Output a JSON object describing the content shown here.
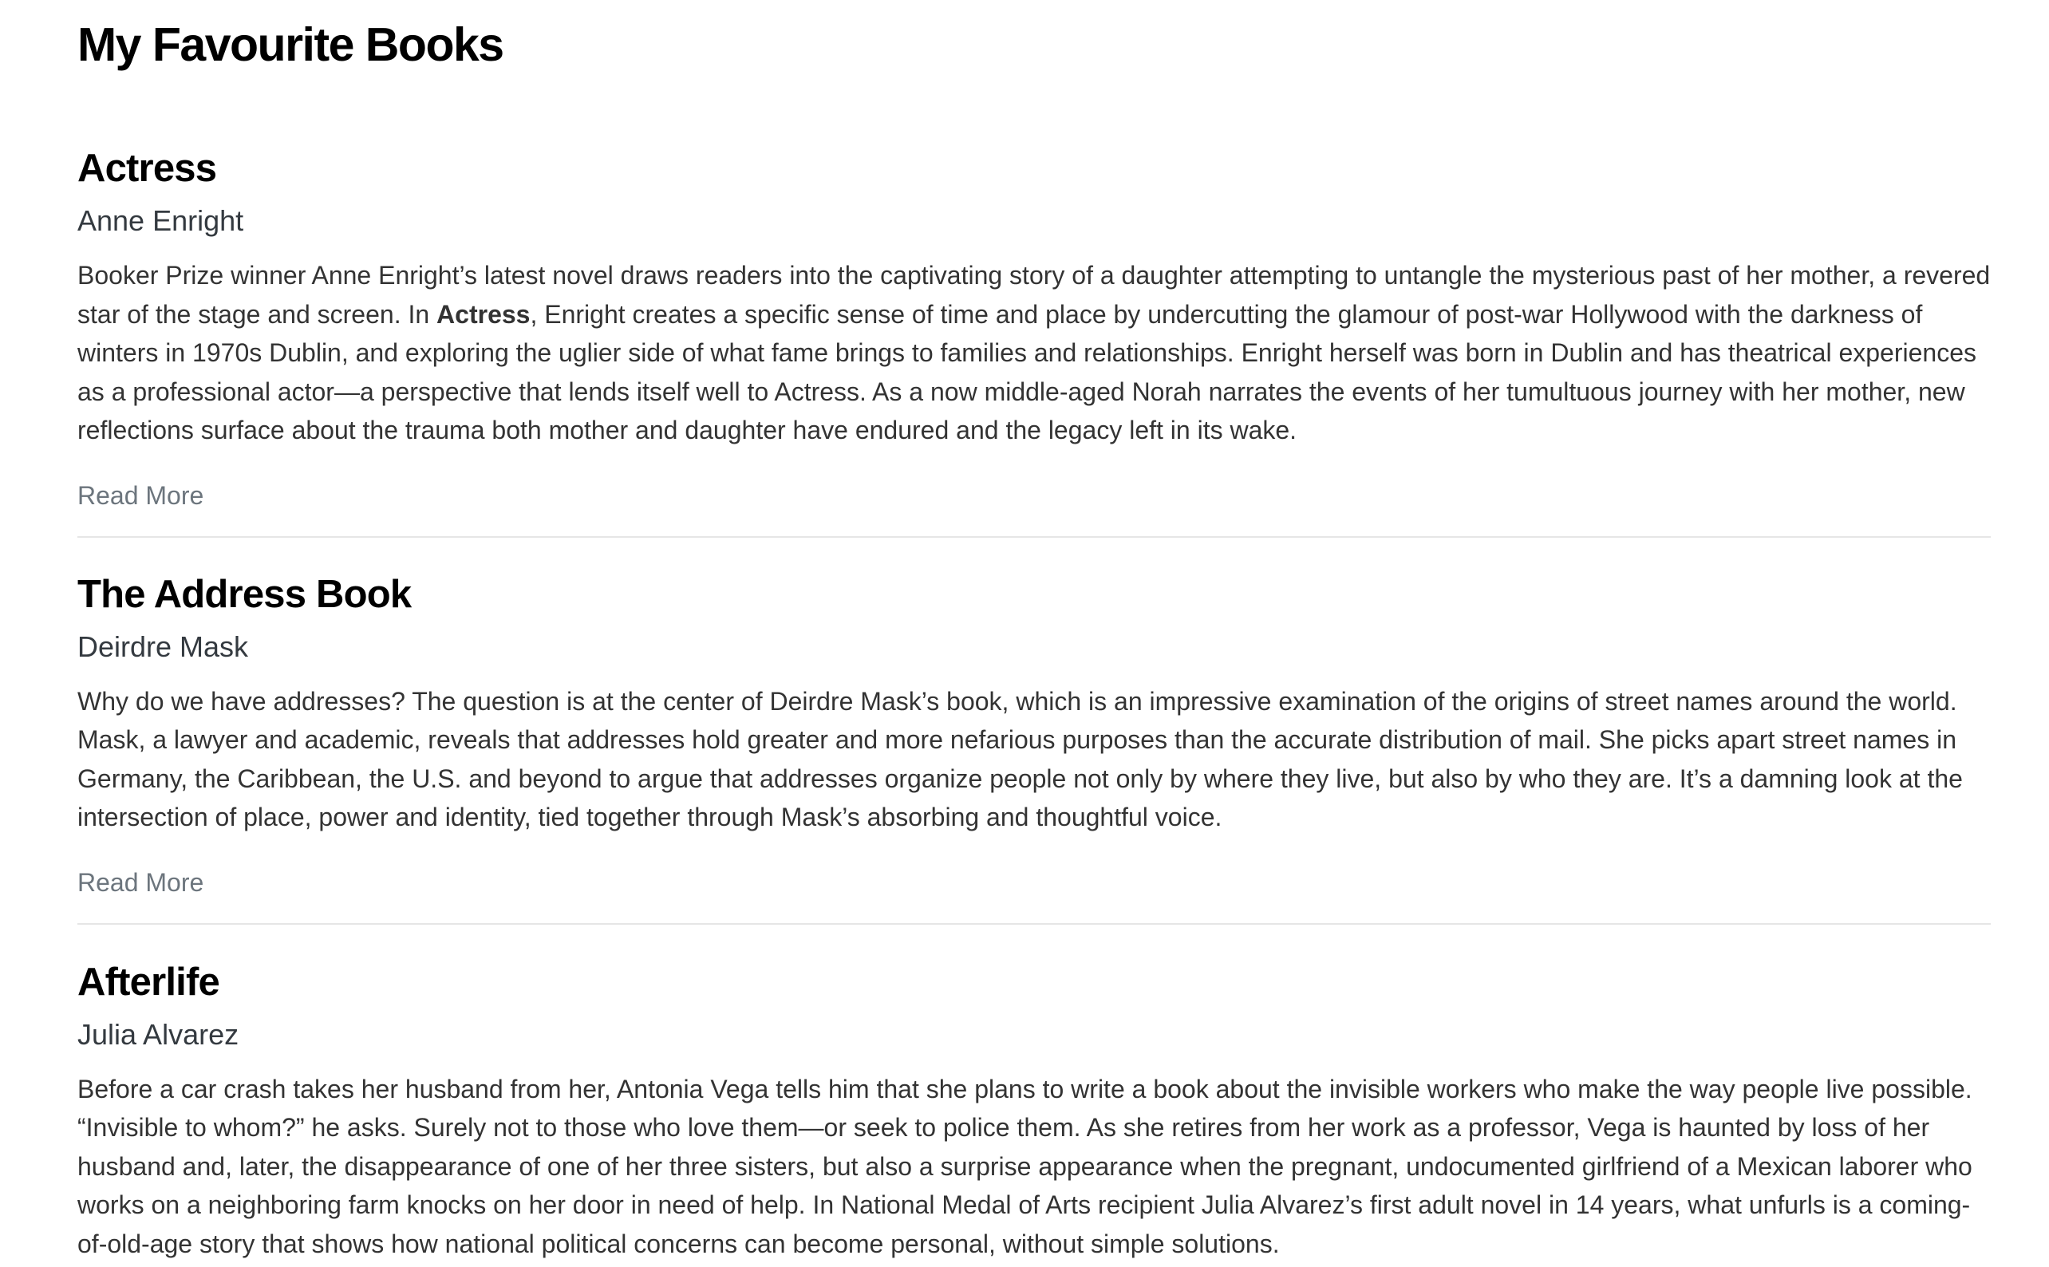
{
  "page": {
    "title": "My Favourite Books"
  },
  "books": [
    {
      "title": "Actress",
      "author": "Anne Enright",
      "description_before": "Booker Prize winner Anne Enright’s latest novel draws readers into the captivating story of a daughter attempting to untangle the mysterious past of her mother, a revered star of the stage and screen. In ",
      "description_bold": "Actress",
      "description_after": ", Enright creates a specific sense of time and place by undercutting the glamour of post-war Hollywood with the darkness of winters in 1970s Dublin, and exploring the uglier side of what fame brings to families and relationships. Enright herself was born in Dublin and has theatrical experiences as a professional actor—a perspective that lends itself well to Actress. As a now middle-aged Norah narrates the events of her tumultuous journey with her mother, new reflections surface about the trauma both mother and daughter have endured and the legacy left in its wake.",
      "read_more": "Read More"
    },
    {
      "title": "The Address Book",
      "author": "Deirdre Mask",
      "description": "Why do we have addresses? The question is at the center of Deirdre Mask’s book, which is an impressive examination of the origins of street names around the world. Mask, a lawyer and academic, reveals that addresses hold greater and more nefarious purposes than the accurate distribution of mail. She picks apart street names in Germany, the Caribbean, the U.S. and beyond to argue that addresses organize people not only by where they live, but also by who they are. It’s a damning look at the intersection of place, power and identity, tied together through Mask’s absorbing and thoughtful voice.",
      "read_more": "Read More"
    },
    {
      "title": "Afterlife",
      "author": "Julia Alvarez",
      "description": "Before a car crash takes her husband from her, Antonia Vega tells him that she plans to write a book about the invisible workers who make the way people live possible. “Invisible to whom?” he asks. Surely not to those who love them—or seek to police them. As she retires from her work as a professor, Vega is haunted by loss of her husband and, later, the disappearance of one of her three sisters, but also a surprise appearance when the pregnant, undocumented girlfriend of a Mexican laborer who works on a neighboring farm knocks on her door in need of help. In National Medal of Arts recipient Julia Alvarez’s first adult novel in 14 years, what unfurls is a coming-of-old-age story that shows how national political concerns can become personal, without simple solutions."
    }
  ]
}
